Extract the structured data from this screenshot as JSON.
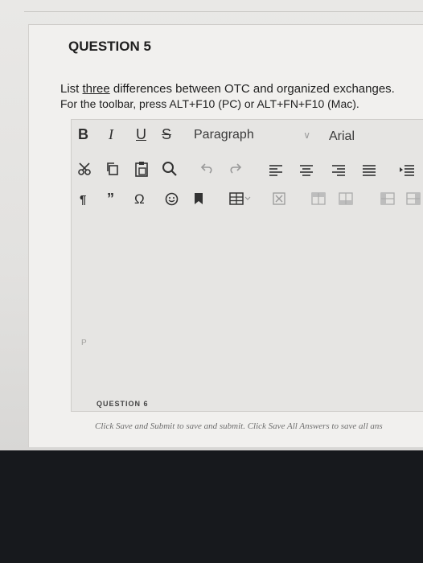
{
  "question": {
    "title": "QUESTION 5",
    "prompt_underlined": "three",
    "prompt_before": "List ",
    "prompt_after": " differences between OTC and organized exchanges.",
    "hint": "For the toolbar, press ALT+F10 (PC) or ALT+FN+F10 (Mac)."
  },
  "toolbar": {
    "bold": "B",
    "italic": "I",
    "underline": "U",
    "strike": "S",
    "paragraph": "Paragraph",
    "font": "Arial"
  },
  "editor": {
    "path_label": "P"
  },
  "footer": {
    "next_title": "QUESTION 6",
    "note": "Click Save and Submit to save and submit. Click Save All Answers to save all ans"
  }
}
